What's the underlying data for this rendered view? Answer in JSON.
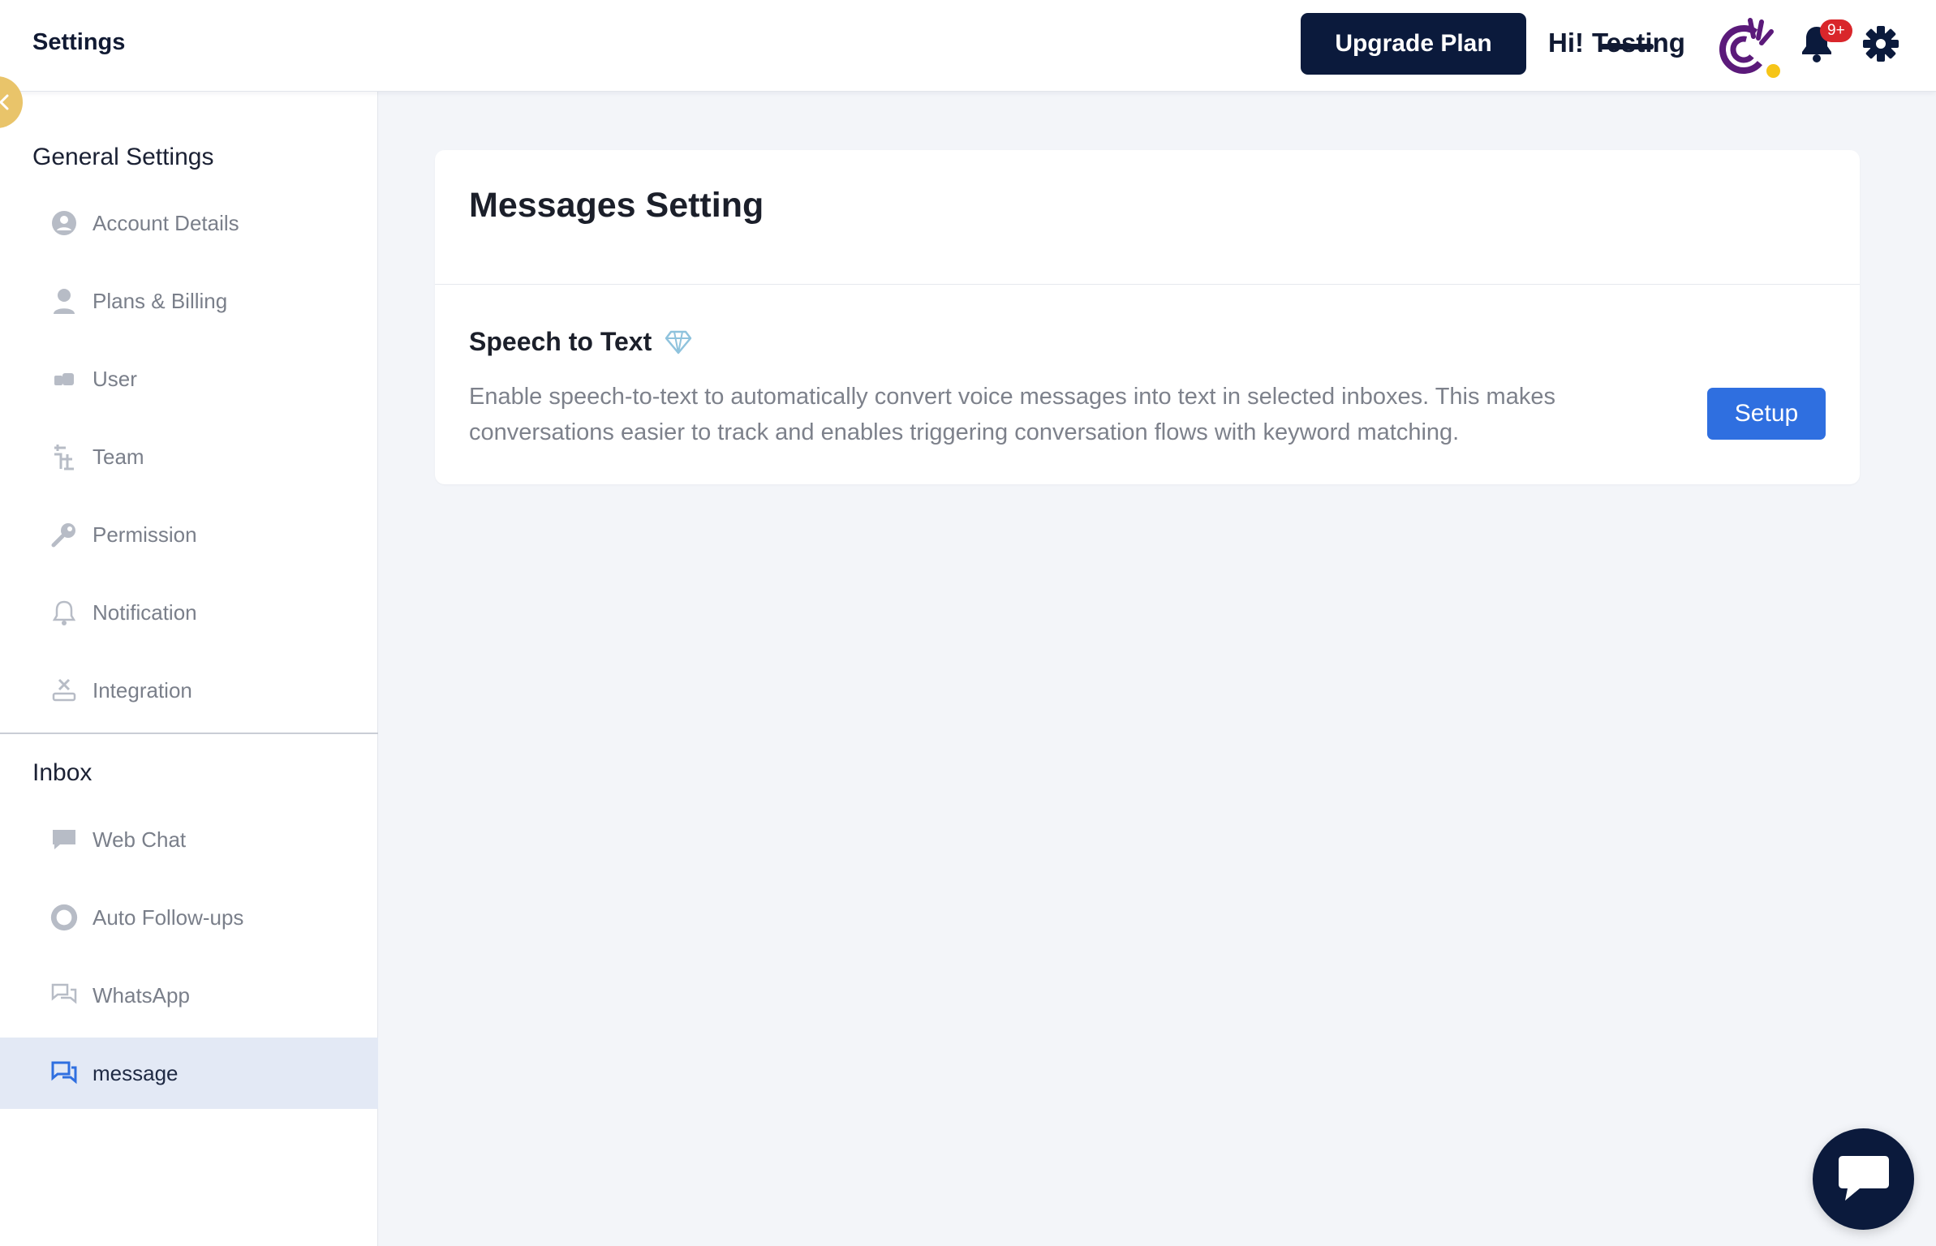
{
  "header": {
    "title": "Settings",
    "upgrade_label": "Upgrade Plan",
    "greeting": "Hi!",
    "user_name": "Testing",
    "notification_badge": "9+"
  },
  "sidebar": {
    "general_title": "General Settings",
    "general_items": [
      {
        "label": "Account Details",
        "icon": "user-circle-icon"
      },
      {
        "label": "Plans & Billing",
        "icon": "person-icon"
      },
      {
        "label": "User",
        "icon": "users-icon"
      },
      {
        "label": "Team",
        "icon": "team-icon"
      },
      {
        "label": "Permission",
        "icon": "key-icon"
      },
      {
        "label": "Notification",
        "icon": "bell-icon"
      },
      {
        "label": "Integration",
        "icon": "integration-icon"
      }
    ],
    "inbox_title": "Inbox",
    "inbox_items": [
      {
        "label": "Web Chat",
        "icon": "chat-bubble-icon"
      },
      {
        "label": "Auto Follow-ups",
        "icon": "circle-chat-icon"
      },
      {
        "label": "WhatsApp",
        "icon": "messages-icon"
      },
      {
        "label": "message",
        "icon": "message-icon",
        "active": true
      }
    ]
  },
  "main": {
    "card_title": "Messages Setting",
    "feature": {
      "title": "Speech to Text",
      "icon": "diamond-icon",
      "description": "Enable speech-to-text to automatically convert voice messages into text in selected inboxes. This makes conversations easier to track and enables triggering conversation flows with keyword matching.",
      "button_label": "Setup"
    }
  },
  "colors": {
    "navy": "#0b1a3c",
    "primary_blue": "#2f6fe0",
    "badge_red": "#d9262b",
    "active_bg": "#e3e9f5",
    "avatar_purple": "#5b1a7a",
    "status_yellow": "#f6c518"
  }
}
